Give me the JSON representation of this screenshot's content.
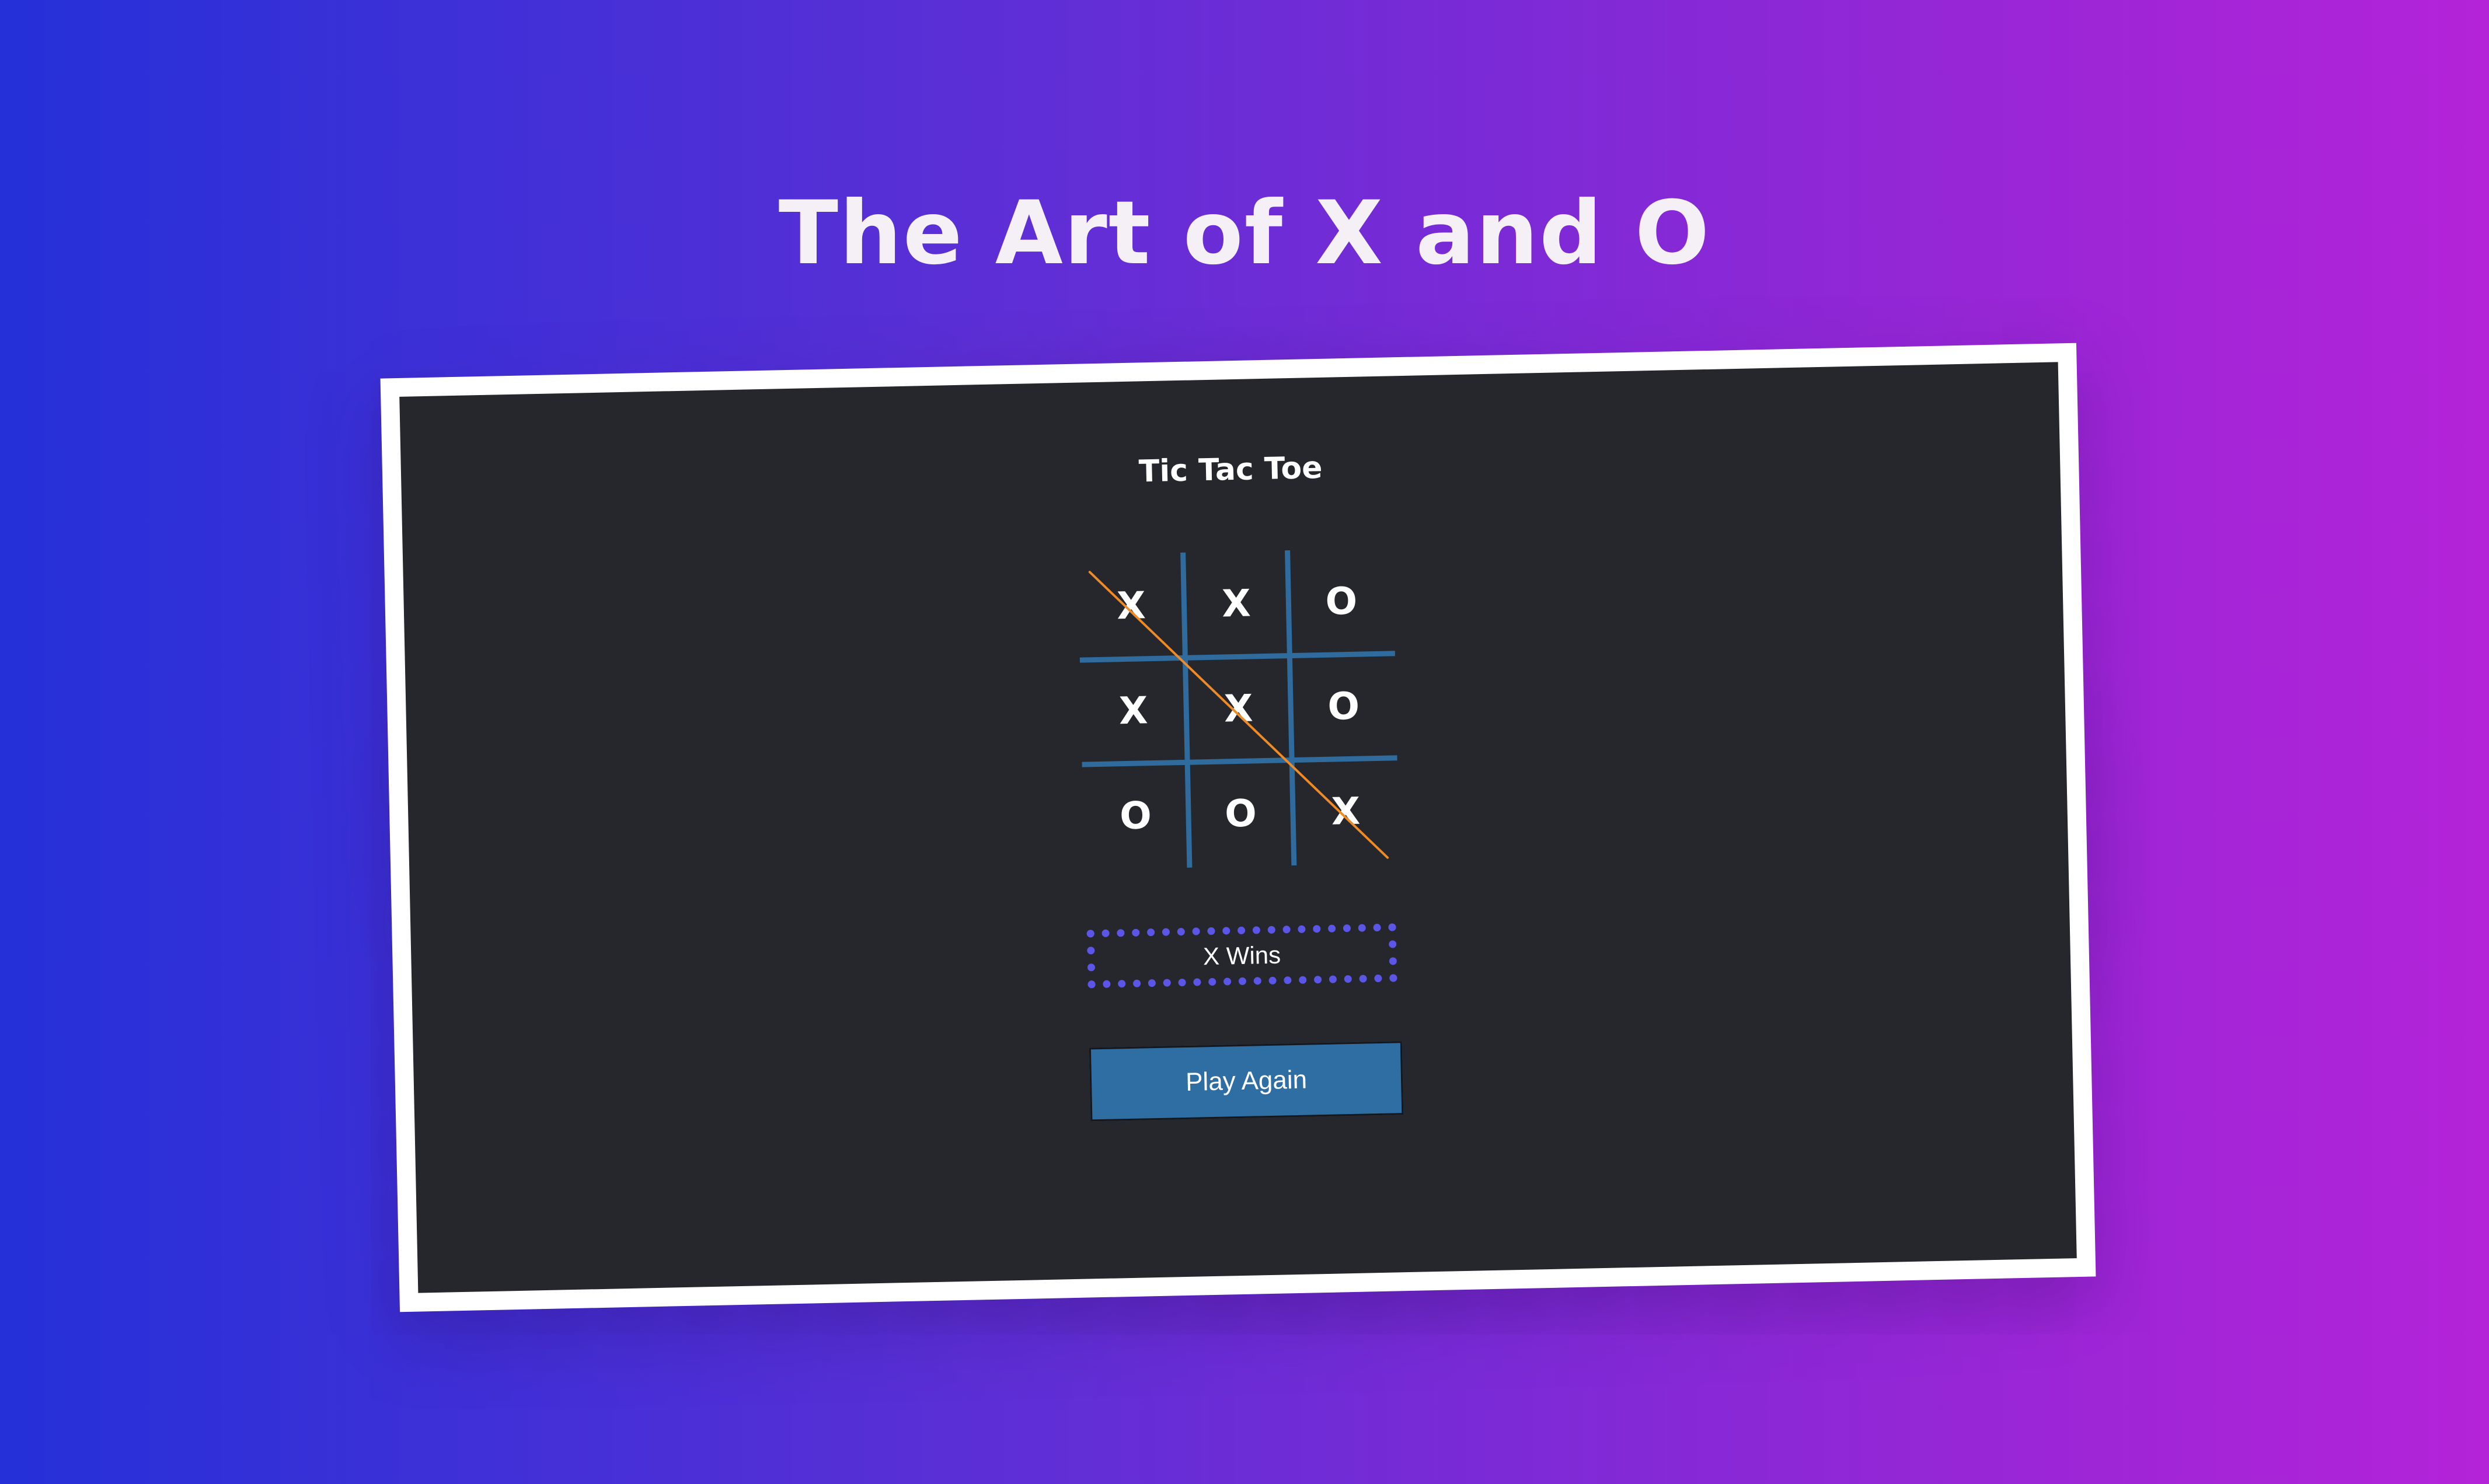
{
  "page": {
    "title": "The Art of X and O"
  },
  "game": {
    "title": "Tic Tac Toe",
    "board": [
      [
        "X",
        "X",
        "O"
      ],
      [
        "X",
        "X",
        "O"
      ],
      [
        "O",
        "O",
        "X"
      ]
    ],
    "winning_line": "diagonal top-left to bottom-right",
    "status": "X Wins",
    "play_again_label": "Play Again"
  },
  "colors": {
    "background_left": "#2530d8",
    "background_right": "#b423d8",
    "panel": "#25272d",
    "grid": "#2f6b9c",
    "strike": "#f08a24",
    "status_border": "#5b56e8",
    "button": "#2e6ea3"
  }
}
